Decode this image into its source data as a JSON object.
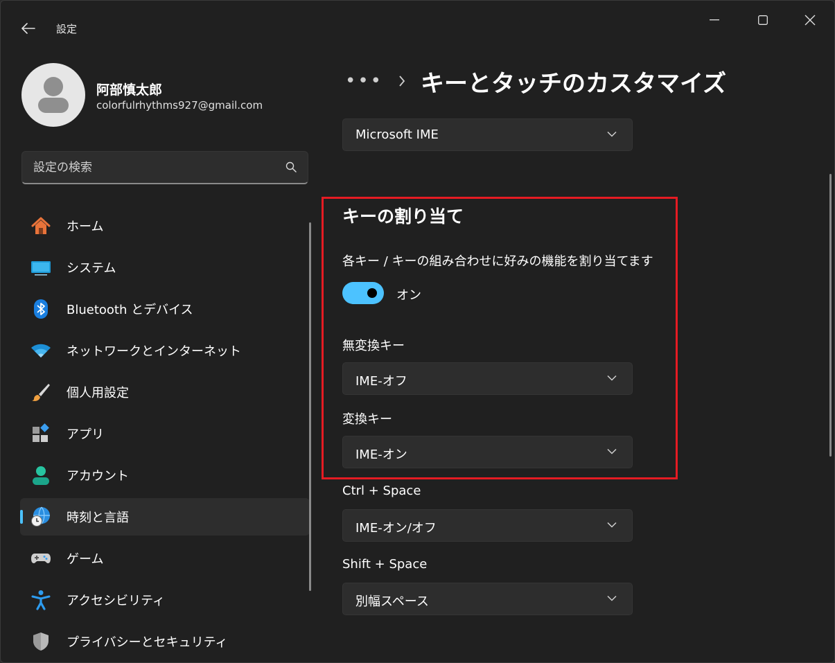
{
  "window": {
    "title": "設定"
  },
  "user": {
    "name": "阿部慎太郎",
    "email": "colorfulrhythms927@gmail.com"
  },
  "search": {
    "placeholder": "設定の検索"
  },
  "nav": {
    "items": [
      {
        "label": "ホーム",
        "icon": "home-icon"
      },
      {
        "label": "システム",
        "icon": "system-icon"
      },
      {
        "label": "Bluetooth とデバイス",
        "icon": "bluetooth-icon"
      },
      {
        "label": "ネットワークとインターネット",
        "icon": "wifi-icon"
      },
      {
        "label": "個人用設定",
        "icon": "brush-icon"
      },
      {
        "label": "アプリ",
        "icon": "apps-icon"
      },
      {
        "label": "アカウント",
        "icon": "account-icon"
      },
      {
        "label": "時刻と言語",
        "icon": "globe-clock-icon",
        "active": true
      },
      {
        "label": "ゲーム",
        "icon": "gamepad-icon"
      },
      {
        "label": "アクセシビリティ",
        "icon": "accessibility-icon"
      },
      {
        "label": "プライバシーとセキュリティ",
        "icon": "shield-icon"
      }
    ]
  },
  "breadcrumb": {
    "ellipsis": "•••",
    "title": "キーとタッチのカスタマイズ"
  },
  "ime_select": {
    "value": "Microsoft IME"
  },
  "key_assignment": {
    "heading": "キーの割り当て",
    "description": "各キー / キーの組み合わせに好みの機能を割り当てます",
    "toggle_state": "オン",
    "toggle_on": true
  },
  "settings": [
    {
      "label": "無変換キー",
      "value": "IME-オフ"
    },
    {
      "label": "変換キー",
      "value": "IME-オン"
    },
    {
      "label": "Ctrl + Space",
      "value": "IME-オン/オフ"
    },
    {
      "label": "Shift + Space",
      "value": "別幅スペース"
    }
  ],
  "colors": {
    "accent": "#4cc2ff",
    "highlight": "#e51b23",
    "background": "#202020"
  }
}
